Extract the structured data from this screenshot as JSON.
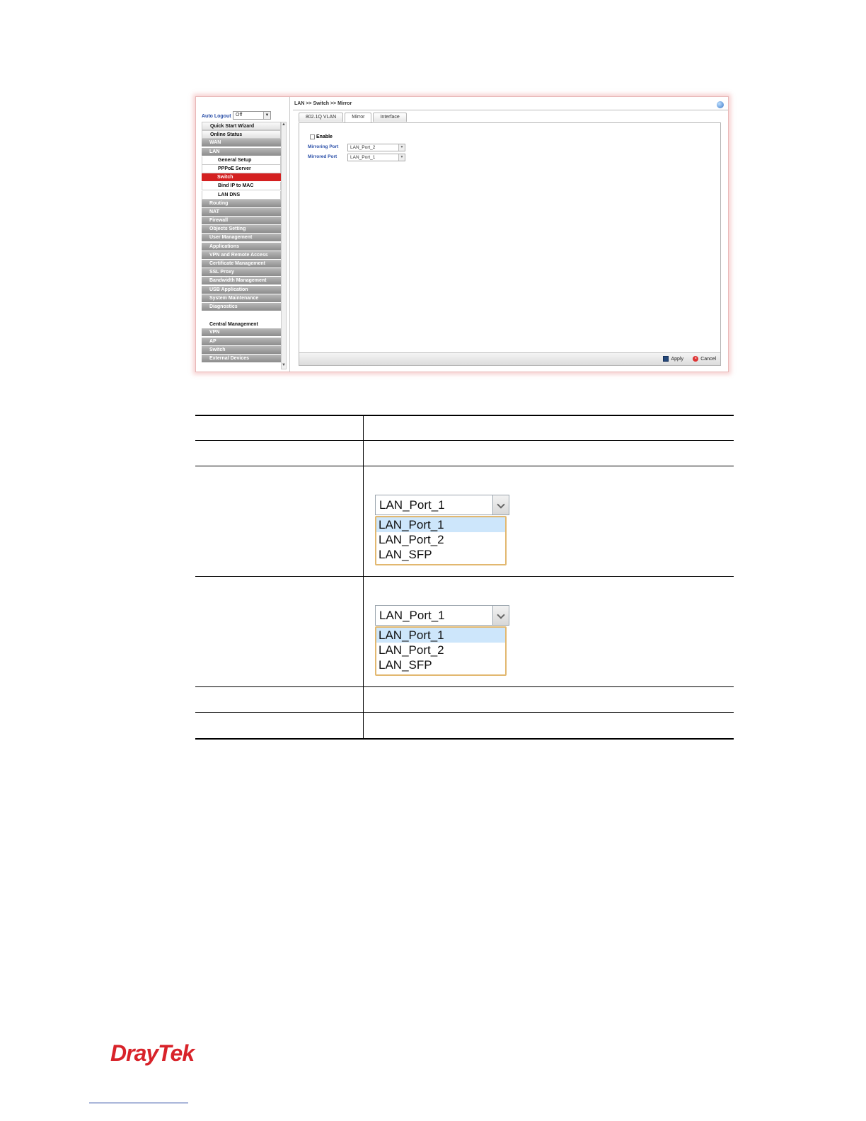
{
  "router_ui": {
    "auto_logout": {
      "label": "Auto Logout",
      "value": "Off"
    },
    "menu": [
      {
        "label": "Quick Start Wizard",
        "kind": "light"
      },
      {
        "label": "Online Status",
        "kind": "light"
      },
      {
        "label": "WAN",
        "kind": "group"
      },
      {
        "label": "LAN",
        "kind": "group"
      },
      {
        "label": "General Setup",
        "kind": "sub"
      },
      {
        "label": "PPPoE Server",
        "kind": "sub"
      },
      {
        "label": "Switch",
        "kind": "active"
      },
      {
        "label": "Bind IP to MAC",
        "kind": "sub"
      },
      {
        "label": "LAN DNS",
        "kind": "sub"
      },
      {
        "label": "Routing",
        "kind": "group"
      },
      {
        "label": "NAT",
        "kind": "group"
      },
      {
        "label": "Firewall",
        "kind": "group"
      },
      {
        "label": "Objects Setting",
        "kind": "group"
      },
      {
        "label": "User Management",
        "kind": "group"
      },
      {
        "label": "Applications",
        "kind": "group"
      },
      {
        "label": "VPN and Remote Access",
        "kind": "group"
      },
      {
        "label": "Certificate Management",
        "kind": "group"
      },
      {
        "label": "SSL Proxy",
        "kind": "group"
      },
      {
        "label": "Bandwidth Management",
        "kind": "group"
      },
      {
        "label": "USB Application",
        "kind": "group"
      },
      {
        "label": "System Maintenance",
        "kind": "group"
      },
      {
        "label": "Diagnostics",
        "kind": "group"
      }
    ],
    "central_management": {
      "heading": "Central Management",
      "items": [
        "VPN",
        "AP",
        "Switch",
        "External Devices"
      ]
    },
    "breadcrumb": "LAN >> Switch >> Mirror",
    "tabs": [
      {
        "label": "802.1Q VLAN",
        "active": false
      },
      {
        "label": "Mirror",
        "active": true
      },
      {
        "label": "Interface",
        "active": false
      }
    ],
    "enable_label": "Enable",
    "mirroring_port": {
      "label": "Mirroring Port",
      "value": "LAN_Port_2"
    },
    "mirrored_port": {
      "label": "Mirrored Port",
      "value": "LAN_Port_1"
    },
    "apply_label": "Apply",
    "cancel_label": "Cancel"
  },
  "dropdown_examples": [
    {
      "value": "LAN_Port_1",
      "options": [
        "LAN_Port_1",
        "LAN_Port_2",
        "LAN_SFP"
      ],
      "selected_index": 0
    },
    {
      "value": "LAN_Port_1",
      "options": [
        "LAN_Port_1",
        "LAN_Port_2",
        "LAN_SFP"
      ],
      "selected_index": 0
    }
  ],
  "logo_text": "DrayTek"
}
